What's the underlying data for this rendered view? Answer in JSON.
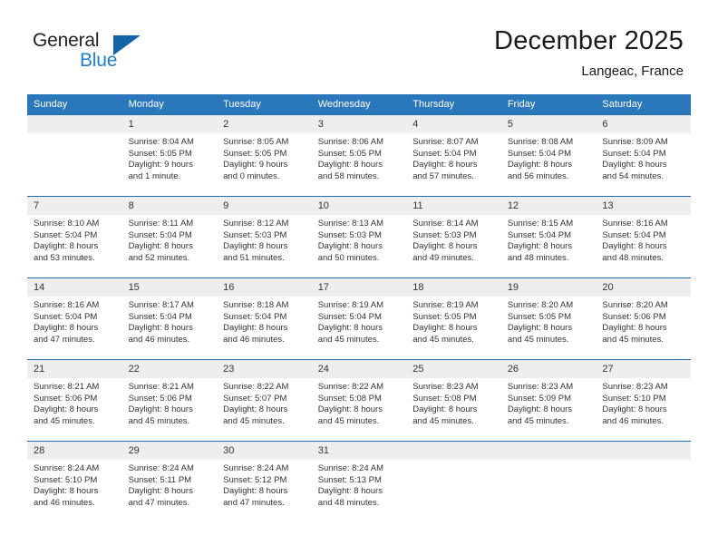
{
  "brand": {
    "name_part1": "General",
    "name_part2": "Blue",
    "accent_color": "#1b7fd4",
    "triangle_color": "#1464ab",
    "logo_icon": "triangle-logo-icon"
  },
  "header": {
    "month_title": "December 2025",
    "location": "Langeac, France"
  },
  "theme": {
    "header_row_background": "#2b77bb",
    "header_row_text": "#ffffff",
    "row_top_border": "#1f6cb0",
    "day_number_band": "#eeeeee",
    "cell_background": "#ffffff",
    "body_text": "#333333"
  },
  "weekday_headers": [
    "Sunday",
    "Monday",
    "Tuesday",
    "Wednesday",
    "Thursday",
    "Friday",
    "Saturday"
  ],
  "weeks": [
    [
      {
        "day": "",
        "empty": true,
        "sunrise": "",
        "sunset": "",
        "daylight_line1": "",
        "daylight_line2": ""
      },
      {
        "day": "1",
        "empty": false,
        "sunrise": "Sunrise: 8:04 AM",
        "sunset": "Sunset: 5:05 PM",
        "daylight_line1": "Daylight: 9 hours",
        "daylight_line2": "and 1 minute."
      },
      {
        "day": "2",
        "empty": false,
        "sunrise": "Sunrise: 8:05 AM",
        "sunset": "Sunset: 5:05 PM",
        "daylight_line1": "Daylight: 9 hours",
        "daylight_line2": "and 0 minutes."
      },
      {
        "day": "3",
        "empty": false,
        "sunrise": "Sunrise: 8:06 AM",
        "sunset": "Sunset: 5:05 PM",
        "daylight_line1": "Daylight: 8 hours",
        "daylight_line2": "and 58 minutes."
      },
      {
        "day": "4",
        "empty": false,
        "sunrise": "Sunrise: 8:07 AM",
        "sunset": "Sunset: 5:04 PM",
        "daylight_line1": "Daylight: 8 hours",
        "daylight_line2": "and 57 minutes."
      },
      {
        "day": "5",
        "empty": false,
        "sunrise": "Sunrise: 8:08 AM",
        "sunset": "Sunset: 5:04 PM",
        "daylight_line1": "Daylight: 8 hours",
        "daylight_line2": "and 56 minutes."
      },
      {
        "day": "6",
        "empty": false,
        "sunrise": "Sunrise: 8:09 AM",
        "sunset": "Sunset: 5:04 PM",
        "daylight_line1": "Daylight: 8 hours",
        "daylight_line2": "and 54 minutes."
      }
    ],
    [
      {
        "day": "7",
        "empty": false,
        "sunrise": "Sunrise: 8:10 AM",
        "sunset": "Sunset: 5:04 PM",
        "daylight_line1": "Daylight: 8 hours",
        "daylight_line2": "and 53 minutes."
      },
      {
        "day": "8",
        "empty": false,
        "sunrise": "Sunrise: 8:11 AM",
        "sunset": "Sunset: 5:04 PM",
        "daylight_line1": "Daylight: 8 hours",
        "daylight_line2": "and 52 minutes."
      },
      {
        "day": "9",
        "empty": false,
        "sunrise": "Sunrise: 8:12 AM",
        "sunset": "Sunset: 5:03 PM",
        "daylight_line1": "Daylight: 8 hours",
        "daylight_line2": "and 51 minutes."
      },
      {
        "day": "10",
        "empty": false,
        "sunrise": "Sunrise: 8:13 AM",
        "sunset": "Sunset: 5:03 PM",
        "daylight_line1": "Daylight: 8 hours",
        "daylight_line2": "and 50 minutes."
      },
      {
        "day": "11",
        "empty": false,
        "sunrise": "Sunrise: 8:14 AM",
        "sunset": "Sunset: 5:03 PM",
        "daylight_line1": "Daylight: 8 hours",
        "daylight_line2": "and 49 minutes."
      },
      {
        "day": "12",
        "empty": false,
        "sunrise": "Sunrise: 8:15 AM",
        "sunset": "Sunset: 5:04 PM",
        "daylight_line1": "Daylight: 8 hours",
        "daylight_line2": "and 48 minutes."
      },
      {
        "day": "13",
        "empty": false,
        "sunrise": "Sunrise: 8:16 AM",
        "sunset": "Sunset: 5:04 PM",
        "daylight_line1": "Daylight: 8 hours",
        "daylight_line2": "and 48 minutes."
      }
    ],
    [
      {
        "day": "14",
        "empty": false,
        "sunrise": "Sunrise: 8:16 AM",
        "sunset": "Sunset: 5:04 PM",
        "daylight_line1": "Daylight: 8 hours",
        "daylight_line2": "and 47 minutes."
      },
      {
        "day": "15",
        "empty": false,
        "sunrise": "Sunrise: 8:17 AM",
        "sunset": "Sunset: 5:04 PM",
        "daylight_line1": "Daylight: 8 hours",
        "daylight_line2": "and 46 minutes."
      },
      {
        "day": "16",
        "empty": false,
        "sunrise": "Sunrise: 8:18 AM",
        "sunset": "Sunset: 5:04 PM",
        "daylight_line1": "Daylight: 8 hours",
        "daylight_line2": "and 46 minutes."
      },
      {
        "day": "17",
        "empty": false,
        "sunrise": "Sunrise: 8:19 AM",
        "sunset": "Sunset: 5:04 PM",
        "daylight_line1": "Daylight: 8 hours",
        "daylight_line2": "and 45 minutes."
      },
      {
        "day": "18",
        "empty": false,
        "sunrise": "Sunrise: 8:19 AM",
        "sunset": "Sunset: 5:05 PM",
        "daylight_line1": "Daylight: 8 hours",
        "daylight_line2": "and 45 minutes."
      },
      {
        "day": "19",
        "empty": false,
        "sunrise": "Sunrise: 8:20 AM",
        "sunset": "Sunset: 5:05 PM",
        "daylight_line1": "Daylight: 8 hours",
        "daylight_line2": "and 45 minutes."
      },
      {
        "day": "20",
        "empty": false,
        "sunrise": "Sunrise: 8:20 AM",
        "sunset": "Sunset: 5:06 PM",
        "daylight_line1": "Daylight: 8 hours",
        "daylight_line2": "and 45 minutes."
      }
    ],
    [
      {
        "day": "21",
        "empty": false,
        "sunrise": "Sunrise: 8:21 AM",
        "sunset": "Sunset: 5:06 PM",
        "daylight_line1": "Daylight: 8 hours",
        "daylight_line2": "and 45 minutes."
      },
      {
        "day": "22",
        "empty": false,
        "sunrise": "Sunrise: 8:21 AM",
        "sunset": "Sunset: 5:06 PM",
        "daylight_line1": "Daylight: 8 hours",
        "daylight_line2": "and 45 minutes."
      },
      {
        "day": "23",
        "empty": false,
        "sunrise": "Sunrise: 8:22 AM",
        "sunset": "Sunset: 5:07 PM",
        "daylight_line1": "Daylight: 8 hours",
        "daylight_line2": "and 45 minutes."
      },
      {
        "day": "24",
        "empty": false,
        "sunrise": "Sunrise: 8:22 AM",
        "sunset": "Sunset: 5:08 PM",
        "daylight_line1": "Daylight: 8 hours",
        "daylight_line2": "and 45 minutes."
      },
      {
        "day": "25",
        "empty": false,
        "sunrise": "Sunrise: 8:23 AM",
        "sunset": "Sunset: 5:08 PM",
        "daylight_line1": "Daylight: 8 hours",
        "daylight_line2": "and 45 minutes."
      },
      {
        "day": "26",
        "empty": false,
        "sunrise": "Sunrise: 8:23 AM",
        "sunset": "Sunset: 5:09 PM",
        "daylight_line1": "Daylight: 8 hours",
        "daylight_line2": "and 45 minutes."
      },
      {
        "day": "27",
        "empty": false,
        "sunrise": "Sunrise: 8:23 AM",
        "sunset": "Sunset: 5:10 PM",
        "daylight_line1": "Daylight: 8 hours",
        "daylight_line2": "and 46 minutes."
      }
    ],
    [
      {
        "day": "28",
        "empty": false,
        "sunrise": "Sunrise: 8:24 AM",
        "sunset": "Sunset: 5:10 PM",
        "daylight_line1": "Daylight: 8 hours",
        "daylight_line2": "and 46 minutes."
      },
      {
        "day": "29",
        "empty": false,
        "sunrise": "Sunrise: 8:24 AM",
        "sunset": "Sunset: 5:11 PM",
        "daylight_line1": "Daylight: 8 hours",
        "daylight_line2": "and 47 minutes."
      },
      {
        "day": "30",
        "empty": false,
        "sunrise": "Sunrise: 8:24 AM",
        "sunset": "Sunset: 5:12 PM",
        "daylight_line1": "Daylight: 8 hours",
        "daylight_line2": "and 47 minutes."
      },
      {
        "day": "31",
        "empty": false,
        "sunrise": "Sunrise: 8:24 AM",
        "sunset": "Sunset: 5:13 PM",
        "daylight_line1": "Daylight: 8 hours",
        "daylight_line2": "and 48 minutes."
      },
      {
        "day": "",
        "empty": true,
        "sunrise": "",
        "sunset": "",
        "daylight_line1": "",
        "daylight_line2": ""
      },
      {
        "day": "",
        "empty": true,
        "sunrise": "",
        "sunset": "",
        "daylight_line1": "",
        "daylight_line2": ""
      },
      {
        "day": "",
        "empty": true,
        "sunrise": "",
        "sunset": "",
        "daylight_line1": "",
        "daylight_line2": ""
      }
    ]
  ]
}
